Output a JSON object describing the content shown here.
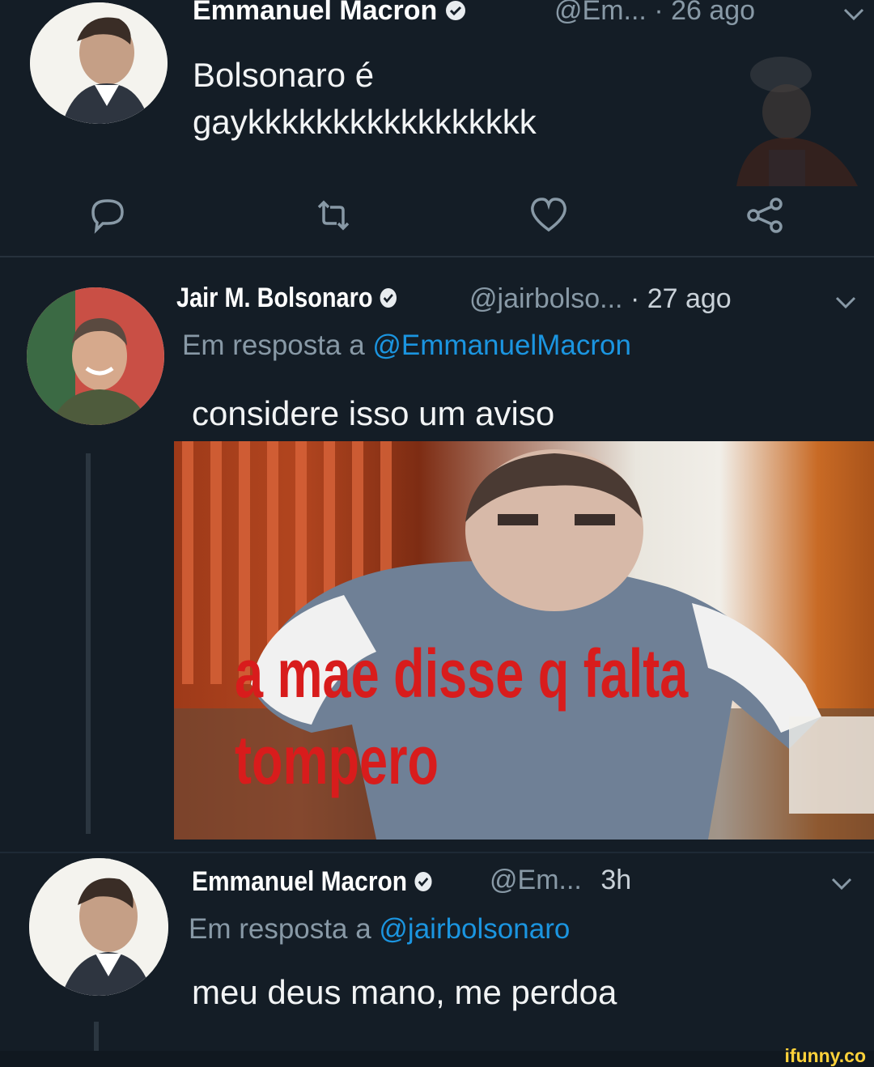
{
  "tweets": [
    {
      "name": "Emmanuel Macron",
      "handle": "@Em...",
      "time": "· 26 ago",
      "text_line1": "Bolsonaro é",
      "text_line2": "gaykkkkkkkkkkkkkkkkk"
    },
    {
      "name": "Jair M. Bolsonaro",
      "handle": "@jairbolso...",
      "time": "· 27 ago",
      "reply_prefix": "Em resposta a",
      "reply_to": "@EmmanuelMacron",
      "text": "considere isso um aviso",
      "image_caption_line1": "a mae disse q falta",
      "image_caption_line2": "tompero"
    },
    {
      "name": "Emmanuel Macron",
      "handle": "@Em...",
      "time": "3h",
      "reply_prefix": "Em resposta a",
      "reply_to": "@jairbolsonaro",
      "text": "meu deus mano, me perdoa"
    }
  ],
  "actions": {
    "icons": [
      "reply-icon",
      "retweet-icon",
      "like-icon",
      "share-icon"
    ]
  },
  "watermark": "ifunny.co",
  "colors": {
    "background": "#141d26",
    "name": "#ffffff",
    "meta": "#8899a6",
    "mention": "#1b95e0",
    "caption": "#d81c1c"
  }
}
